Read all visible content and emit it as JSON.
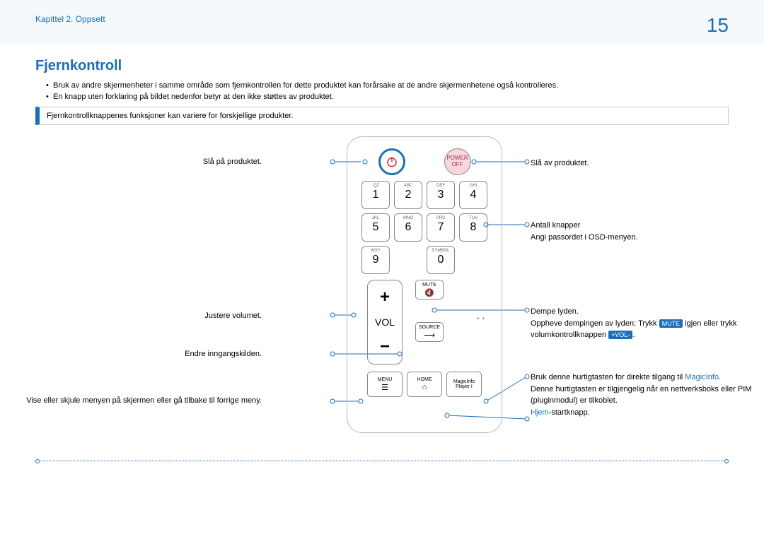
{
  "header": {
    "chapter": "Kapittel 2. Oppsett",
    "page": "15"
  },
  "title": "Fjernkontroll",
  "bullets": [
    "Bruk av andre skjermenheter i samme område som fjernkontrollen for dette produktet kan forårsake at de andre skjermenhetene også kontrolleres.",
    "En knapp uten forklaring på bildet nedenfor betyr at den ikke støttes av produktet."
  ],
  "note": "Fjernkontrollknappenes funksjoner kan variere for forskjellige produkter.",
  "labels": {
    "power_on": "Slå på produktet.",
    "power_off": "Slå av produktet.",
    "num1": "Antall knapper",
    "num2": "Angi passordet i OSD-menyen.",
    "mute1": "Dempe lyden.",
    "mute2_a": "Oppheve dempingen av lyden: Trykk ",
    "mute2_b": " igjen eller trykk",
    "mute3": "volumkontrollknappen ",
    "vol": "Justere volumet.",
    "source": "Endre inngangskilden.",
    "menu": "Vise eller skjule menyen på skjermen eller gå tilbake til forrige meny.",
    "magicinfo1_a": "Bruk denne hurtigtasten for direkte tilgang til ",
    "magicinfo1_b": "MagicInfo",
    "magicinfo2": "Denne hurtigtasten er tilgjengelig når en nettverksboks eller PIM (pluginmodul) er tilkoblet.",
    "home_a": "Hjem",
    "home_b": "-startknapp.",
    "mute_badge": "MUTE",
    "vol_badge": "+VOL-"
  },
  "remote": {
    "power_off": "POWER\nOFF",
    "keys": [
      {
        "n": "1",
        "s": ".QZ"
      },
      {
        "n": "2",
        "s": "ABC"
      },
      {
        "n": "3",
        "s": "DEF"
      },
      {
        "n": "4",
        "s": "GHI"
      },
      {
        "n": "5",
        "s": "JKL"
      },
      {
        "n": "6",
        "s": "MNO"
      },
      {
        "n": "7",
        "s": "PRS"
      },
      {
        "n": "8",
        "s": "TUV"
      },
      {
        "n": "9",
        "s": "WXY"
      },
      {
        "n": "0",
        "s": "SYMBOL"
      }
    ],
    "mute": "MUTE",
    "source": "SOURCE",
    "vol": "VOL",
    "menu": "MENU",
    "home": "HOME",
    "mi1": "MagicInfo",
    "mi2": "Player I"
  }
}
